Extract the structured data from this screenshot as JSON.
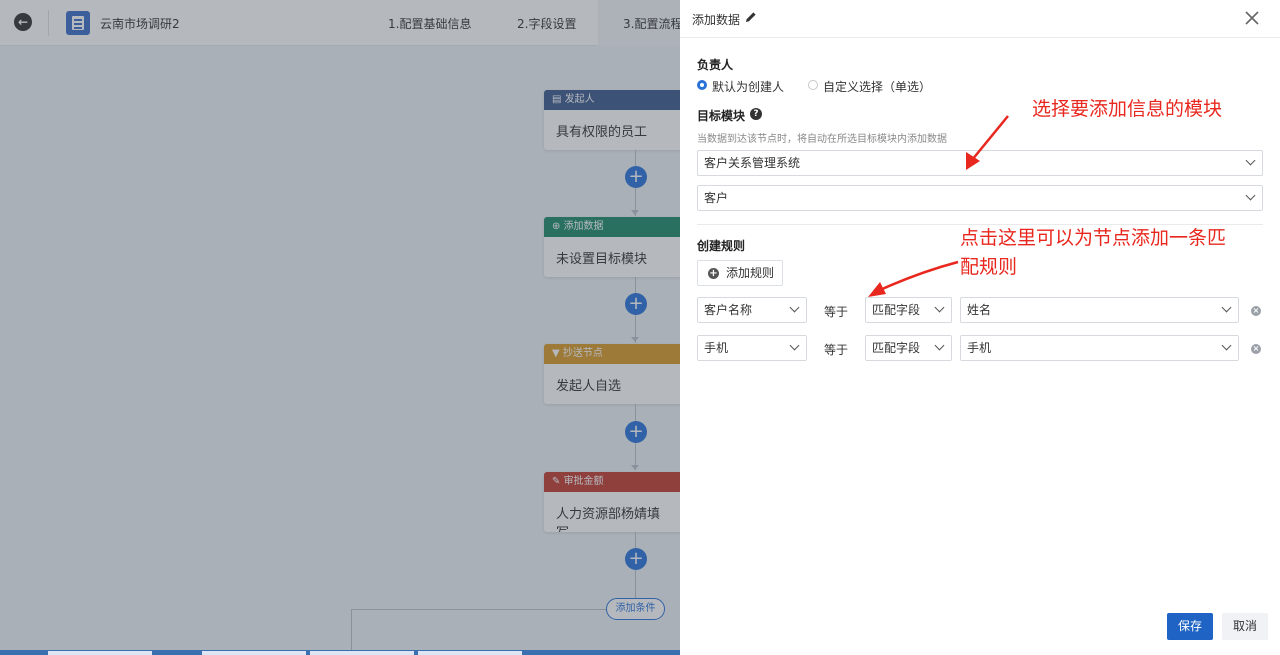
{
  "header": {
    "app_title": "云南市场调研2",
    "steps": [
      "1.配置基础信息",
      "2.字段设置",
      "3.配置流程"
    ]
  },
  "flow": {
    "nodes": [
      {
        "type": "发起人",
        "body": "具有权限的员工",
        "color": "#3d5a8c"
      },
      {
        "type": "添加数据",
        "body": "未设置目标模块",
        "color": "#1f8a6a"
      },
      {
        "type": "抄送节点",
        "body": "发起人自选",
        "color": "#d89a28"
      },
      {
        "type": "审批金额",
        "body": "人力资源部杨婧填写",
        "color": "#c23a2e"
      }
    ],
    "add_condition": "添加条件"
  },
  "drawer": {
    "title": "添加数据",
    "owner_label": "负责人",
    "owner_options": [
      "默认为创建人",
      "自定义选择（单选）"
    ],
    "selected_owner": "默认为创建人",
    "target_label": "目标模块",
    "target_hint": "当数据到达该节点时，将自动在所选目标模块内添加数据",
    "target_system": "客户关系管理系统",
    "target_module": "客户",
    "rule_label": "创建规则",
    "add_rule": "添加规则",
    "rules": [
      {
        "field": "客户名称",
        "op": "等于",
        "mode": "匹配字段",
        "value": "姓名"
      },
      {
        "field": "手机",
        "op": "等于",
        "mode": "匹配字段",
        "value": "手机"
      }
    ],
    "save": "保存",
    "cancel": "取消"
  },
  "annotations": {
    "a1": "选择要添加信息的模块",
    "a2_line1": "点击这里可以为节点添加一条匹",
    "a2_line2": "配规则",
    "color": "#e8281e"
  }
}
